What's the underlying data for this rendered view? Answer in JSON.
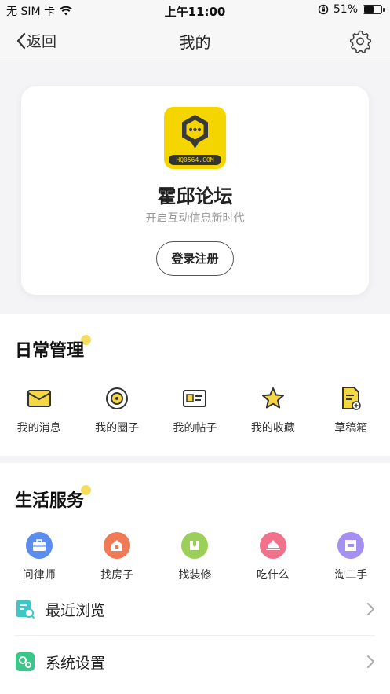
{
  "status_bar": {
    "carrier": "无 SIM 卡",
    "time": "上午11:00",
    "battery_text": "51%",
    "battery_level": 0.51
  },
  "nav": {
    "back_label": "返回",
    "title": "我的"
  },
  "profile": {
    "logo_domain": "HQ0564.COM",
    "app_name": "霍邱论坛",
    "slogan": "开启互动信息新时代",
    "login_button": "登录注册"
  },
  "daily": {
    "title": "日常管理",
    "items": [
      {
        "label": "我的消息",
        "icon": "envelope-icon"
      },
      {
        "label": "我的圈子",
        "icon": "disc-icon"
      },
      {
        "label": "我的帖子",
        "icon": "id-card-icon"
      },
      {
        "label": "我的收藏",
        "icon": "star-icon"
      },
      {
        "label": "草稿箱",
        "icon": "draft-icon"
      }
    ]
  },
  "life": {
    "title": "生活服务",
    "items": [
      {
        "label": "问律师",
        "icon": "briefcase-icon",
        "color": "#5b8def"
      },
      {
        "label": "找房子",
        "icon": "house-icon",
        "color": "#f07a55"
      },
      {
        "label": "找装修",
        "icon": "decor-icon",
        "color": "#9bcf5a"
      },
      {
        "label": "吃什么",
        "icon": "dish-icon",
        "color": "#f0738b"
      },
      {
        "label": "淘二手",
        "icon": "shop-icon",
        "color": "#a58ff0"
      }
    ]
  },
  "rows": [
    {
      "label": "最近浏览",
      "icon": "history-icon",
      "color": "#3fc7c7"
    },
    {
      "label": "系统设置",
      "icon": "settings-icon",
      "color": "#3cc78a"
    }
  ],
  "colors": {
    "accent_yellow": "#f5d500",
    "dot_yellow": "#f5d742"
  }
}
